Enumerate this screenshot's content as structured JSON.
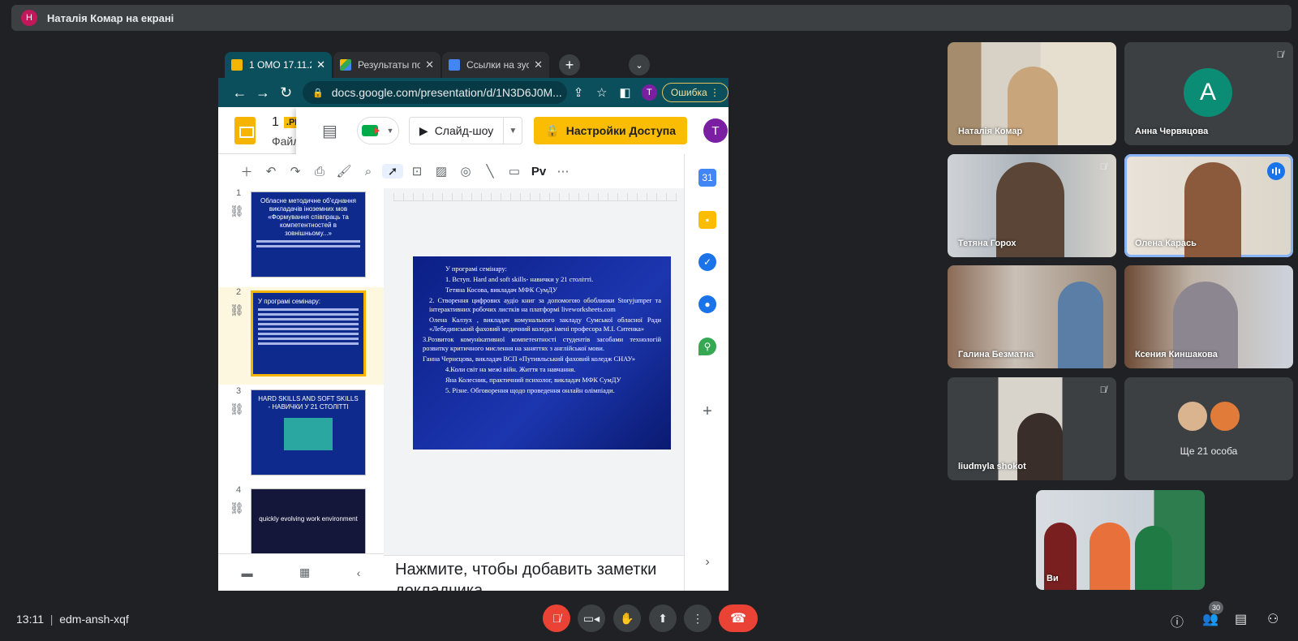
{
  "presenter_bar": {
    "avatar_letter": "Н",
    "text": "Наталія Комар на екрані"
  },
  "browser": {
    "tabs": [
      {
        "label": "1 ОМО 17.11.2",
        "icon": "slides-icon",
        "color": "#f4b400",
        "active": true
      },
      {
        "label": "Результаты по",
        "icon": "drive-icon",
        "color": "#34a853",
        "active": false
      },
      {
        "label": "Ссылки на зус",
        "icon": "docs-icon",
        "color": "#4285f4",
        "active": false
      }
    ],
    "url": "docs.google.com/presentation/d/1N3D6J0M...",
    "profile_letter": "T",
    "error_label": "Ошибка"
  },
  "slides_app": {
    "title": "1",
    "tag": ".PI",
    "file_menu": "Файл",
    "slideshow_label": "Слайд-шоу",
    "access_label": "Настройки Доступа",
    "user_letter": "T",
    "toolbar_text_style": "Pv",
    "filmstrip": [
      {
        "num": "1",
        "title": "Обласне методичне об'єднання викладачів іноземних мов «Формування співпраць та компетентностей в зовнішньому...»"
      },
      {
        "num": "2",
        "title": "У програмі семінару:"
      },
      {
        "num": "3",
        "title": "HARD SKILLS AND SOFT SKILLS - НАВИЧКИ У 21 СТОЛІТТІ"
      },
      {
        "num": "4",
        "title": "quickly evolving work environment"
      }
    ],
    "slide_content": [
      "У програмі семінару:",
      "1. Вступ. Hard and soft skills- навички у 21 столітті.",
      "Тетяна Косова, викладач МФК СумДУ",
      "2. Створення цифрових аудіо книг за допомогою обоблиоки Storyjumper та інтерактивних робочих листків на платформі liveworksheets.com",
      "Олена Калзух , викладач комунального закладу Сумської обласної Ради «Лебединський фаховий медичний коледж імені професора М.І. Ситенка»",
      "3.Розвиток комунікативної компетентності студентів засобами технологій розвитку критичного мислення на заняттях з англійської мови.",
      "Ганна Чернєцова, викладач ВСП «Путивльський фаховий коледж СНАУ»",
      "4.Коли світ на межі війн. Життя та навчання.",
      "Яна Колесник, практичний психолог, викладач МФК СумДУ",
      "5. Різне. Обговорення щодо проведення онлайн олімпіади."
    ],
    "notes_placeholder": "Нажмите, чтобы добавить заметки докладчика"
  },
  "participants": [
    {
      "name": "Наталія Комар",
      "muted": false,
      "kind": "video"
    },
    {
      "name": "Анна Червяцова",
      "muted": true,
      "kind": "avatar",
      "letter": "A",
      "color": "#0b8c75"
    },
    {
      "name": "Тетяна Горох",
      "muted": true,
      "kind": "video"
    },
    {
      "name": "Олена Карась",
      "muted": false,
      "kind": "video",
      "speaking": true
    },
    {
      "name": "Галина Безматна",
      "muted": false,
      "kind": "video"
    },
    {
      "name": "Ксения Киншакова",
      "muted": false,
      "kind": "video"
    },
    {
      "name": "liudmyla shokot",
      "muted": true,
      "kind": "video"
    },
    {
      "name": "Ще 21 особа",
      "kind": "more"
    }
  ],
  "self_tile": {
    "name": "Ви"
  },
  "bottom": {
    "time": "13:11",
    "separator": "|",
    "meeting_code": "edm-ansh-xqf",
    "participant_count": "30"
  }
}
